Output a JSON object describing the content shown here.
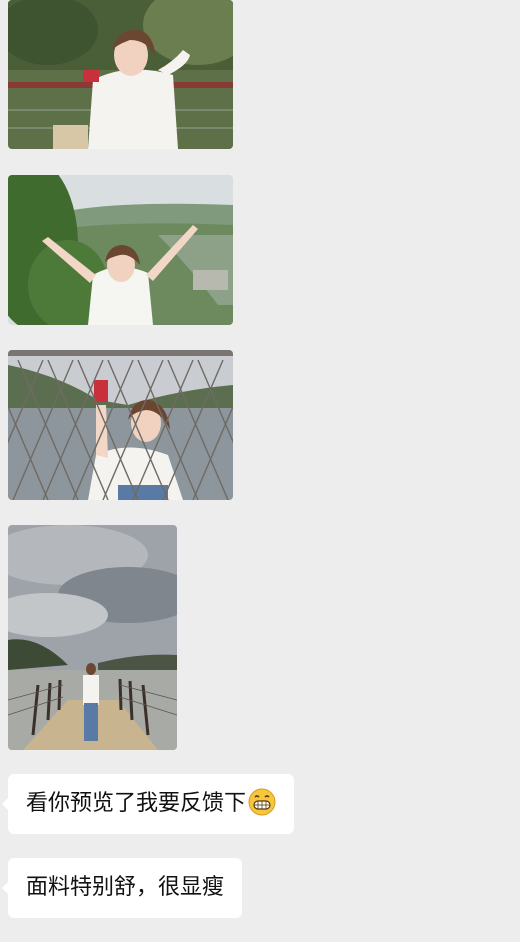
{
  "chat": {
    "messages": [
      {
        "type": "image",
        "name": "photo-woman-railing-card"
      },
      {
        "type": "image",
        "name": "photo-woman-arms-raised-valley"
      },
      {
        "type": "image",
        "name": "photo-woman-fence-lake"
      },
      {
        "type": "image",
        "name": "photo-woman-on-pier"
      },
      {
        "type": "text",
        "text": "看你预览了我要反馈下",
        "emoji": "grinning-face-emoji"
      },
      {
        "type": "text",
        "text": "面料特别舒，很显瘦"
      }
    ]
  },
  "colors": {
    "background": "#ededed",
    "bubble": "#ffffff",
    "text": "#111111"
  }
}
